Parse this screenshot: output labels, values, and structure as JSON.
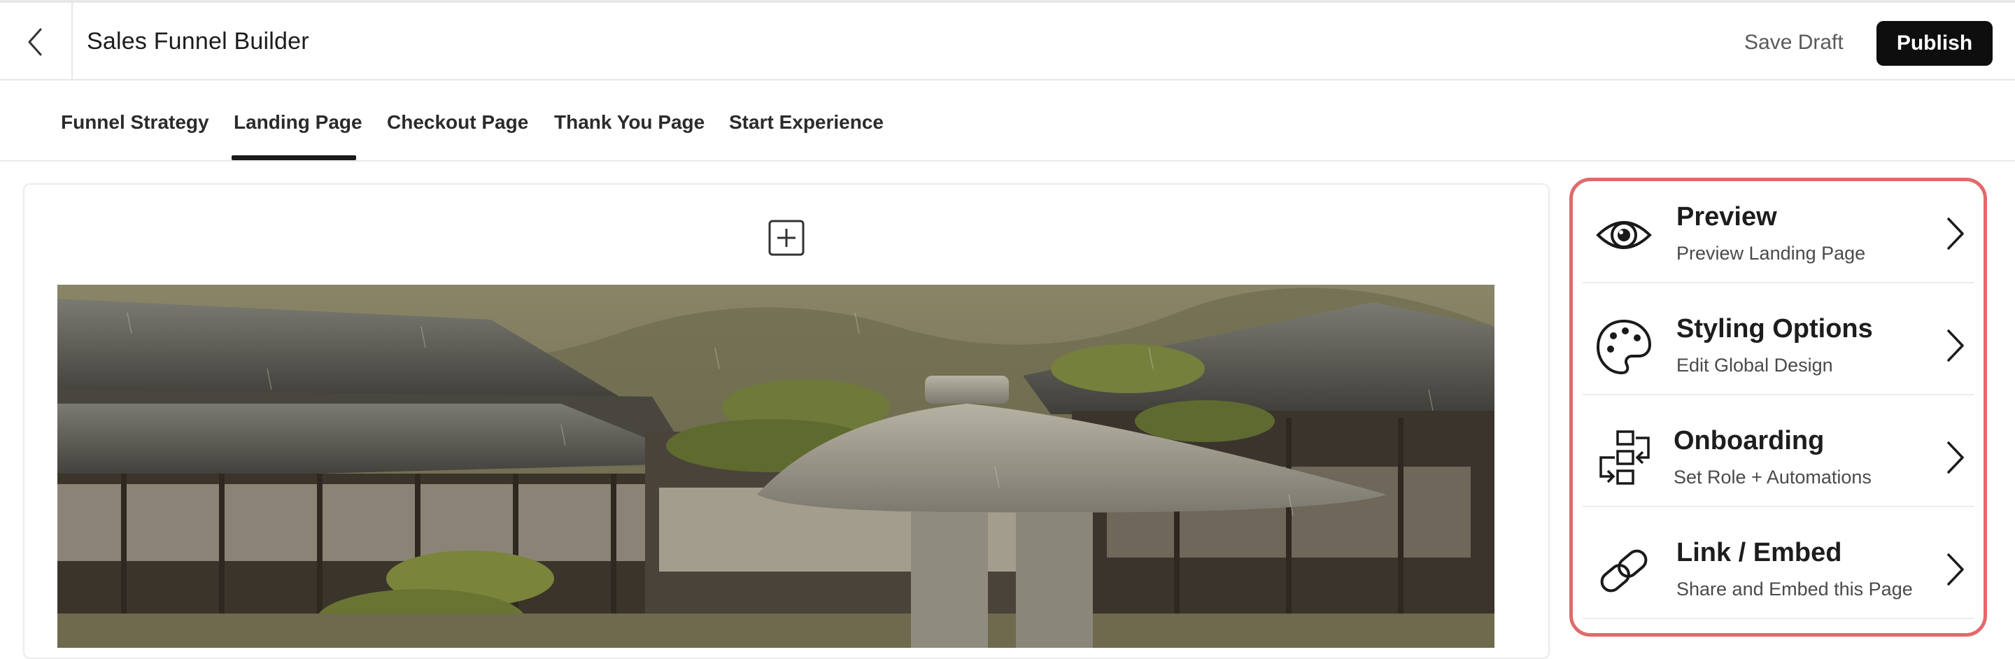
{
  "header": {
    "title": "Sales Funnel Builder",
    "back_icon": "chevron-left-icon",
    "save_draft_label": "Save Draft",
    "publish_label": "Publish"
  },
  "tabs": [
    {
      "label": "Funnel Strategy",
      "active": false
    },
    {
      "label": "Landing Page",
      "active": true
    },
    {
      "label": "Checkout Page",
      "active": false
    },
    {
      "label": "Thank You Page",
      "active": false
    },
    {
      "label": "Start Experience",
      "active": false
    }
  ],
  "canvas": {
    "add_block_icon": "plus-square-icon",
    "hero_image": "photo of a Japanese garden with stone lantern in the rain"
  },
  "side_panel": {
    "highlight_color": "#e2696b",
    "items": [
      {
        "title": "Preview",
        "subtitle": "Preview Landing Page",
        "icon": "eye-icon"
      },
      {
        "title": "Styling Options",
        "subtitle": "Edit Global Design",
        "icon": "palette-icon"
      },
      {
        "title": "Onboarding",
        "subtitle": "Set Role + Automations",
        "icon": "workflow-icon"
      },
      {
        "title": "Link / Embed",
        "subtitle": "Share and Embed this Page",
        "icon": "link-icon"
      }
    ]
  },
  "colors": {
    "publish_bg": "#0e0e0e",
    "accent_outline": "#e2696b"
  }
}
